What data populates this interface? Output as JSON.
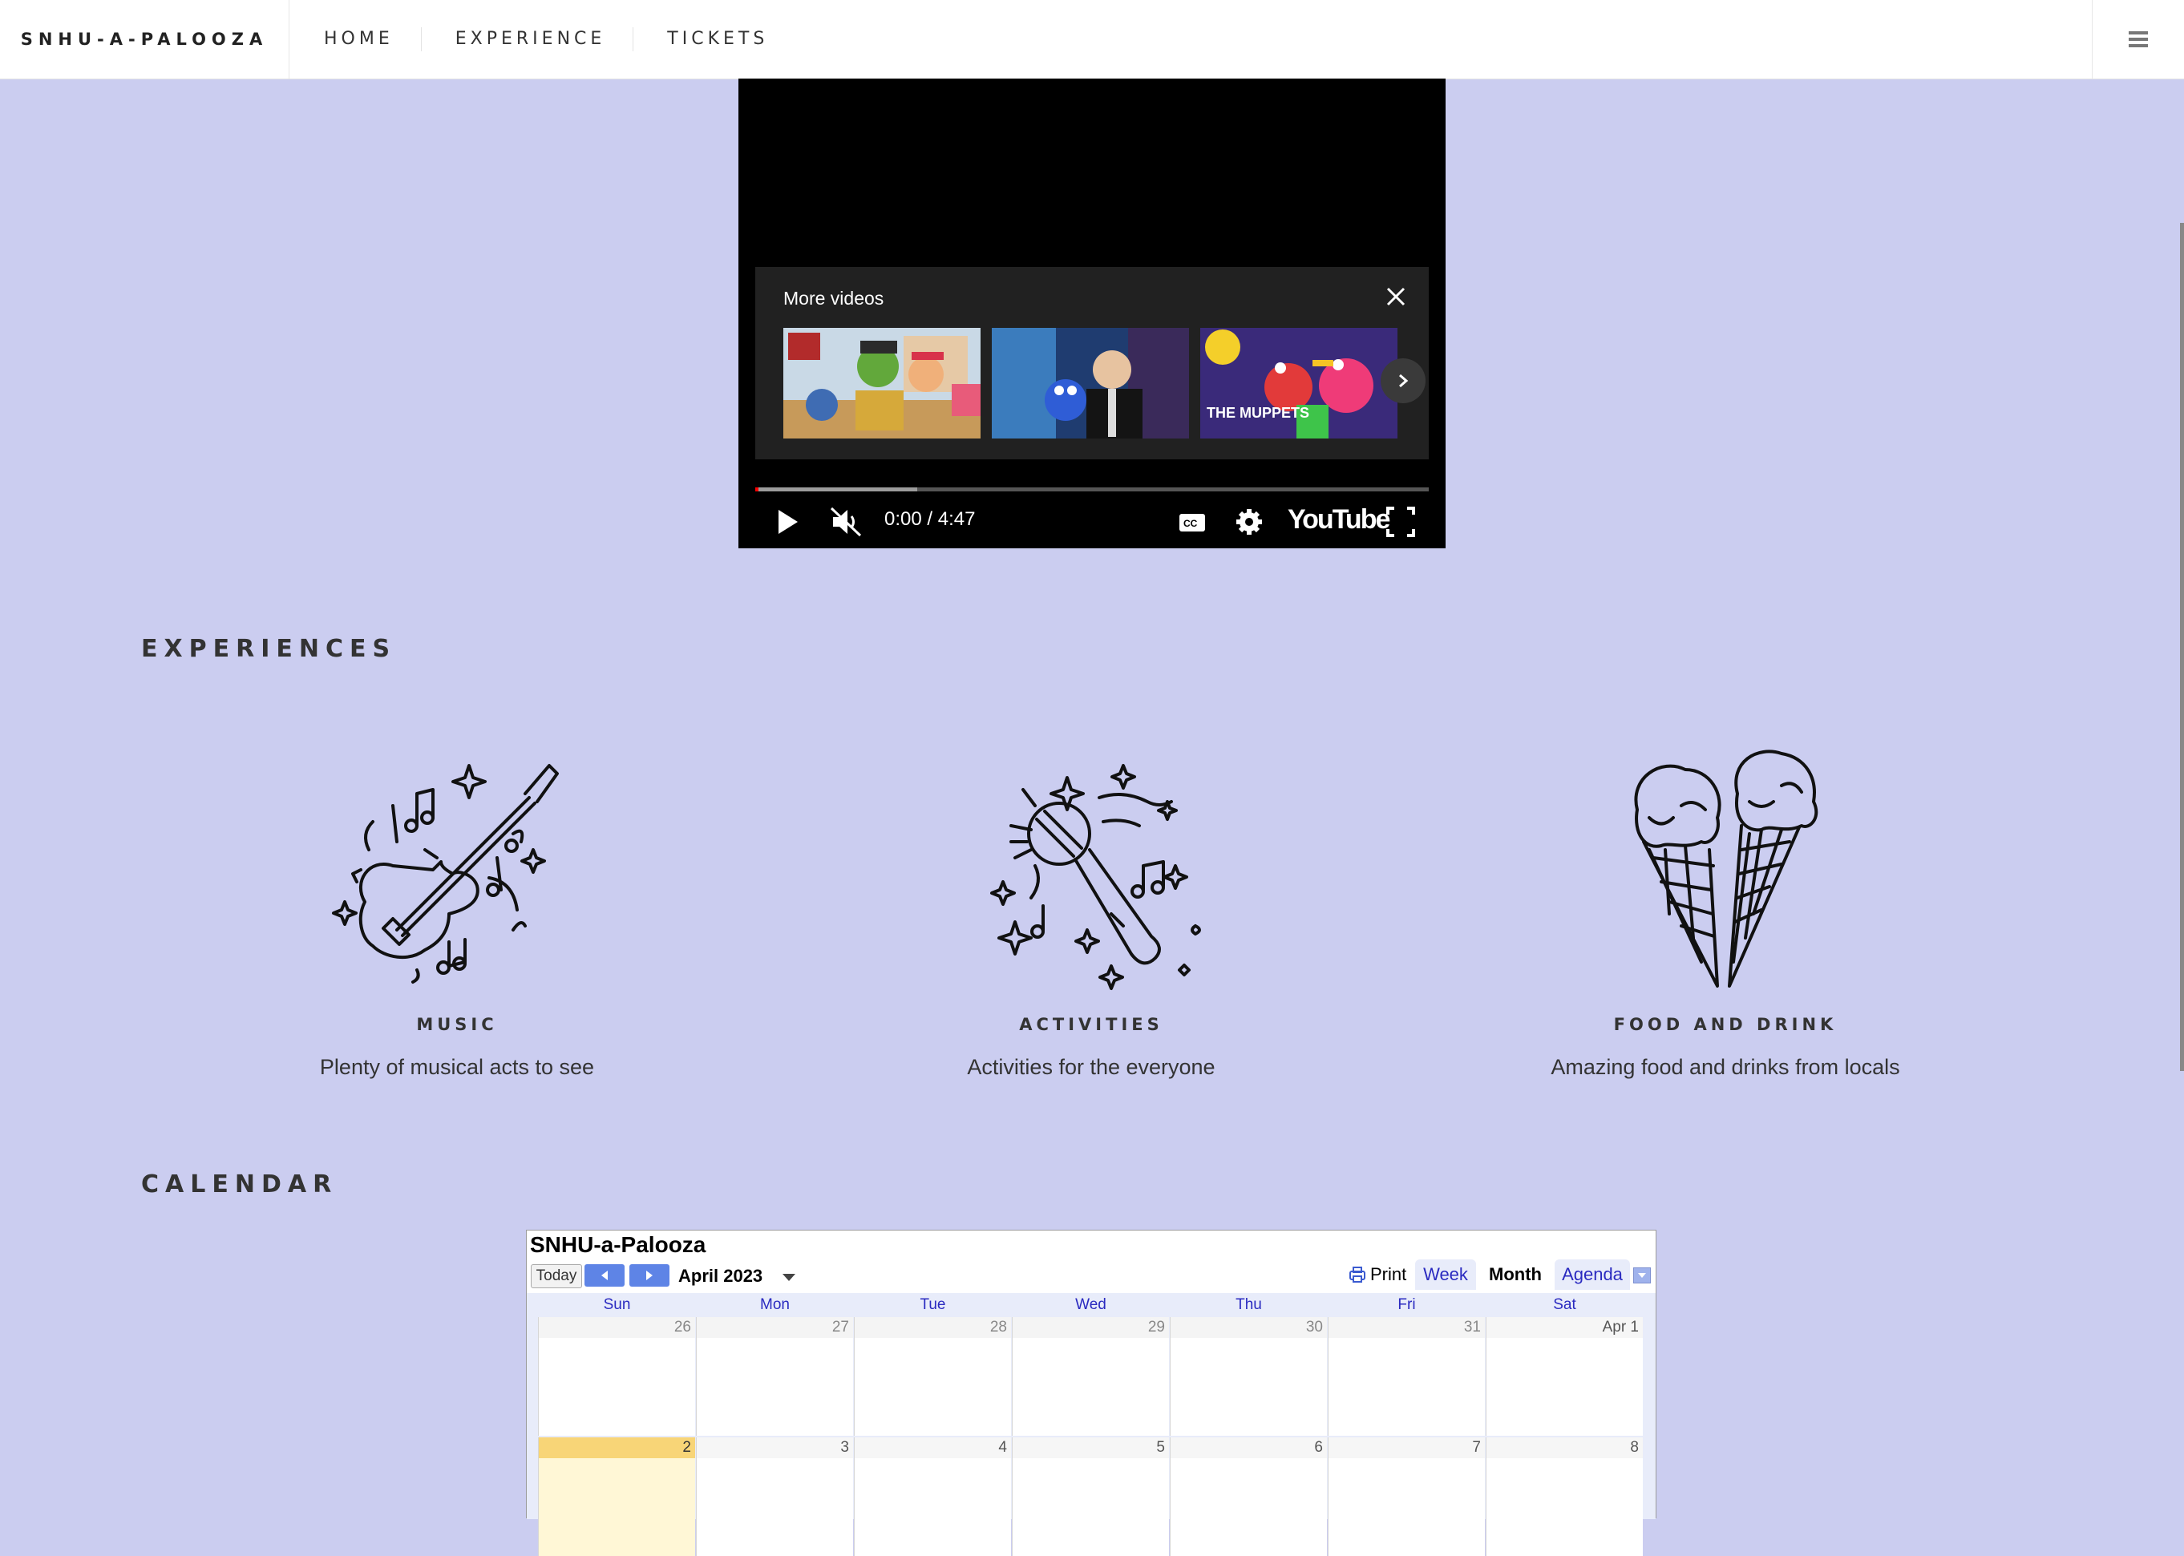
{
  "nav": {
    "brand": "SNHU-A-PALOOZA",
    "links": [
      "HOME",
      "EXPERIENCE",
      "TICKETS"
    ],
    "menu_icon": "hamburger-icon"
  },
  "video": {
    "more_title": "More videos",
    "time": "0:00 / 4:47",
    "logo": "YouTube",
    "progress_buffered": 0.24,
    "thumbnails": [
      "muppet-treasure-island",
      "cookie-monster-late-night",
      "the-muppets-show"
    ],
    "thumb3_caption": "THE MUPPETS"
  },
  "experiences": {
    "title": "EXPERIENCES",
    "items": [
      {
        "title": "MUSIC",
        "desc": "Plenty of musical acts to see",
        "icon": "guitar-icon"
      },
      {
        "title": "ACTIVITIES",
        "desc": "Activities for the everyone",
        "icon": "microphone-icon"
      },
      {
        "title": "FOOD AND DRINK",
        "desc": "Amazing food and drinks from locals",
        "icon": "ice-cream-icon"
      }
    ]
  },
  "calendar": {
    "section_title": "CALENDAR",
    "title": "SNHU-a-Palooza",
    "today_label": "Today",
    "month": "April 2023",
    "print_label": "Print",
    "views": [
      "Week",
      "Month",
      "Agenda"
    ],
    "active_view": "Month",
    "days": [
      "Sun",
      "Mon",
      "Tue",
      "Wed",
      "Thu",
      "Fri",
      "Sat"
    ],
    "week1": [
      "26",
      "27",
      "28",
      "29",
      "30",
      "31",
      "Apr 1"
    ],
    "week2": [
      "2",
      "3",
      "4",
      "5",
      "6",
      "7",
      "8"
    ],
    "today": "2",
    "colors": {
      "background": "#cbcdf0",
      "today": "#f8d577",
      "nav_button": "#5e84e6"
    }
  }
}
